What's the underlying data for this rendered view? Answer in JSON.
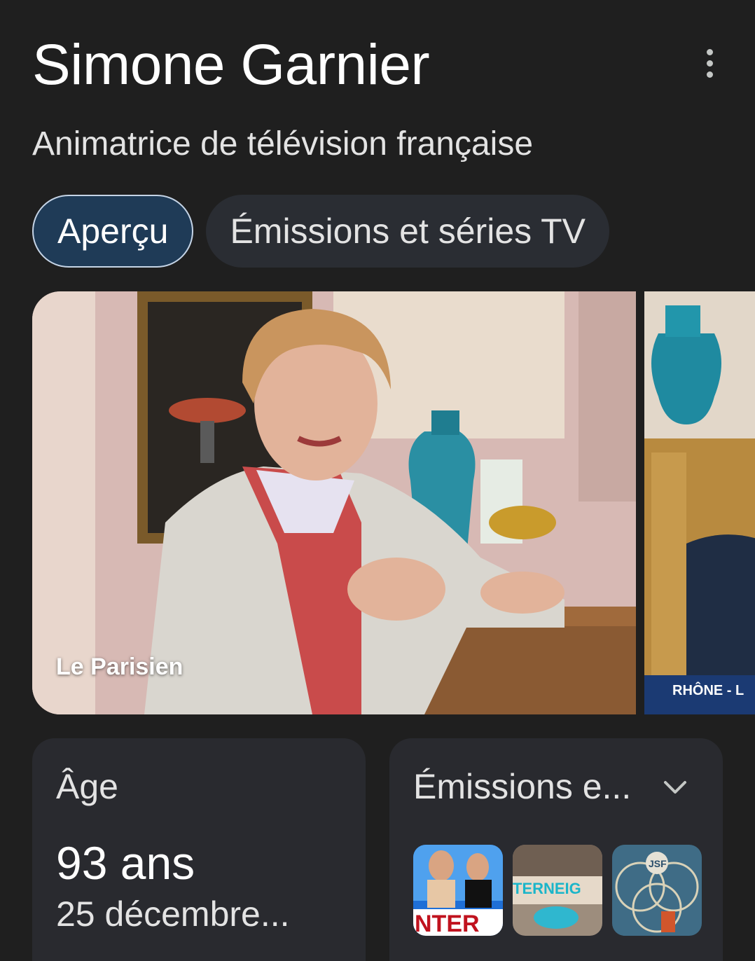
{
  "header": {
    "title": "Simone Garnier",
    "subtitle": "Animatrice de télévision française"
  },
  "tabs": [
    {
      "label": "Aperçu",
      "active": true
    },
    {
      "label": "Émissions et séries TV",
      "active": false
    }
  ],
  "images": {
    "main_source": "Le Parisien",
    "second_caption": "RHÔNE - L"
  },
  "cards": {
    "age": {
      "label": "Âge",
      "value": "93 ans",
      "date": "25 décembre..."
    },
    "shows": {
      "label": "Émissions e...",
      "thumbnails": [
        {
          "text": "NTER"
        },
        {
          "text": "TERNEIG"
        },
        {
          "text": "JSF"
        }
      ]
    }
  },
  "colors": {
    "background": "#1f1f1f",
    "card": "#292a2f",
    "active_tab": "#1f3b57"
  }
}
